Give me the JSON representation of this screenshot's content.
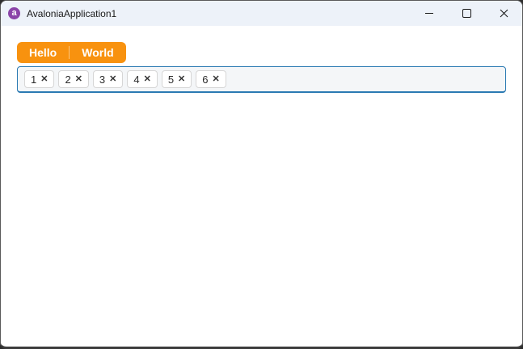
{
  "window": {
    "title": "AvaloniaApplication1"
  },
  "titlebar": {
    "app_icon_glyph": "a",
    "controls": {
      "minimize_label": "Minimize",
      "maximize_label": "Maximize",
      "close_label": "Close"
    }
  },
  "tabs": [
    {
      "label": "Hello"
    },
    {
      "label": "World"
    }
  ],
  "tag_input": {
    "chips": [
      {
        "label": "1"
      },
      {
        "label": "2"
      },
      {
        "label": "3"
      },
      {
        "label": "4"
      },
      {
        "label": "5"
      },
      {
        "label": "6"
      }
    ],
    "remove_glyph": "✕"
  },
  "colors": {
    "accent_orange": "#F8920F",
    "focus_border": "#2B7AB3",
    "titlebar_bg": "#EDF2F9",
    "logo_purple": "#8B44A8",
    "chipbox_bg": "#F4F6F8"
  }
}
